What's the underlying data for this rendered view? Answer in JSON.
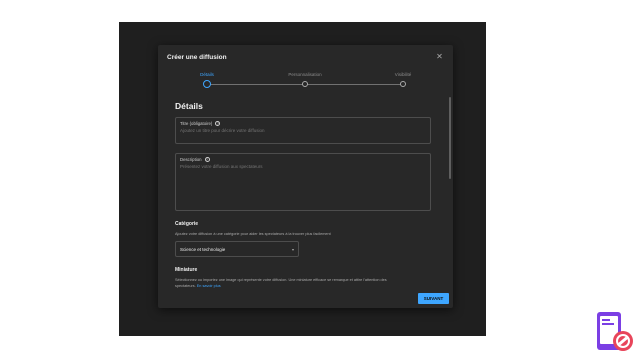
{
  "dialog": {
    "title": "Créer une diffusion",
    "close_icon": "close-icon"
  },
  "stepper": {
    "steps": [
      {
        "label": "Détails",
        "active": true
      },
      {
        "label": "Personnalisation",
        "active": false
      },
      {
        "label": "Visibilité",
        "active": false
      }
    ]
  },
  "details": {
    "heading": "Détails",
    "title_field": {
      "label": "Titre (obligatoire)",
      "placeholder": "Ajoutez un titre pour décrire votre diffusion"
    },
    "description_field": {
      "label": "Description",
      "placeholder": "Présentez votre diffusion aux spectateurs"
    }
  },
  "category": {
    "heading": "Catégorie",
    "text": "Ajoutez votre diffusion à une catégorie pour aider les spectateurs à la trouver plus facilement",
    "selected": "Science et technologie"
  },
  "thumbnail": {
    "heading": "Miniature",
    "text": "Sélectionnez ou importez une image qui représente votre diffusion. Une miniature efficace se remarque et attire l'attention des",
    "text2": "spectateurs.",
    "link": "En savoir plus"
  },
  "footer": {
    "next_label": "SUIVANT"
  },
  "colors": {
    "accent": "#3ea6ff",
    "dialog_bg": "#282828",
    "backdrop": "#1f1f1f",
    "logo_purple": "#7b3fe4",
    "logo_red": "#e8455a"
  }
}
